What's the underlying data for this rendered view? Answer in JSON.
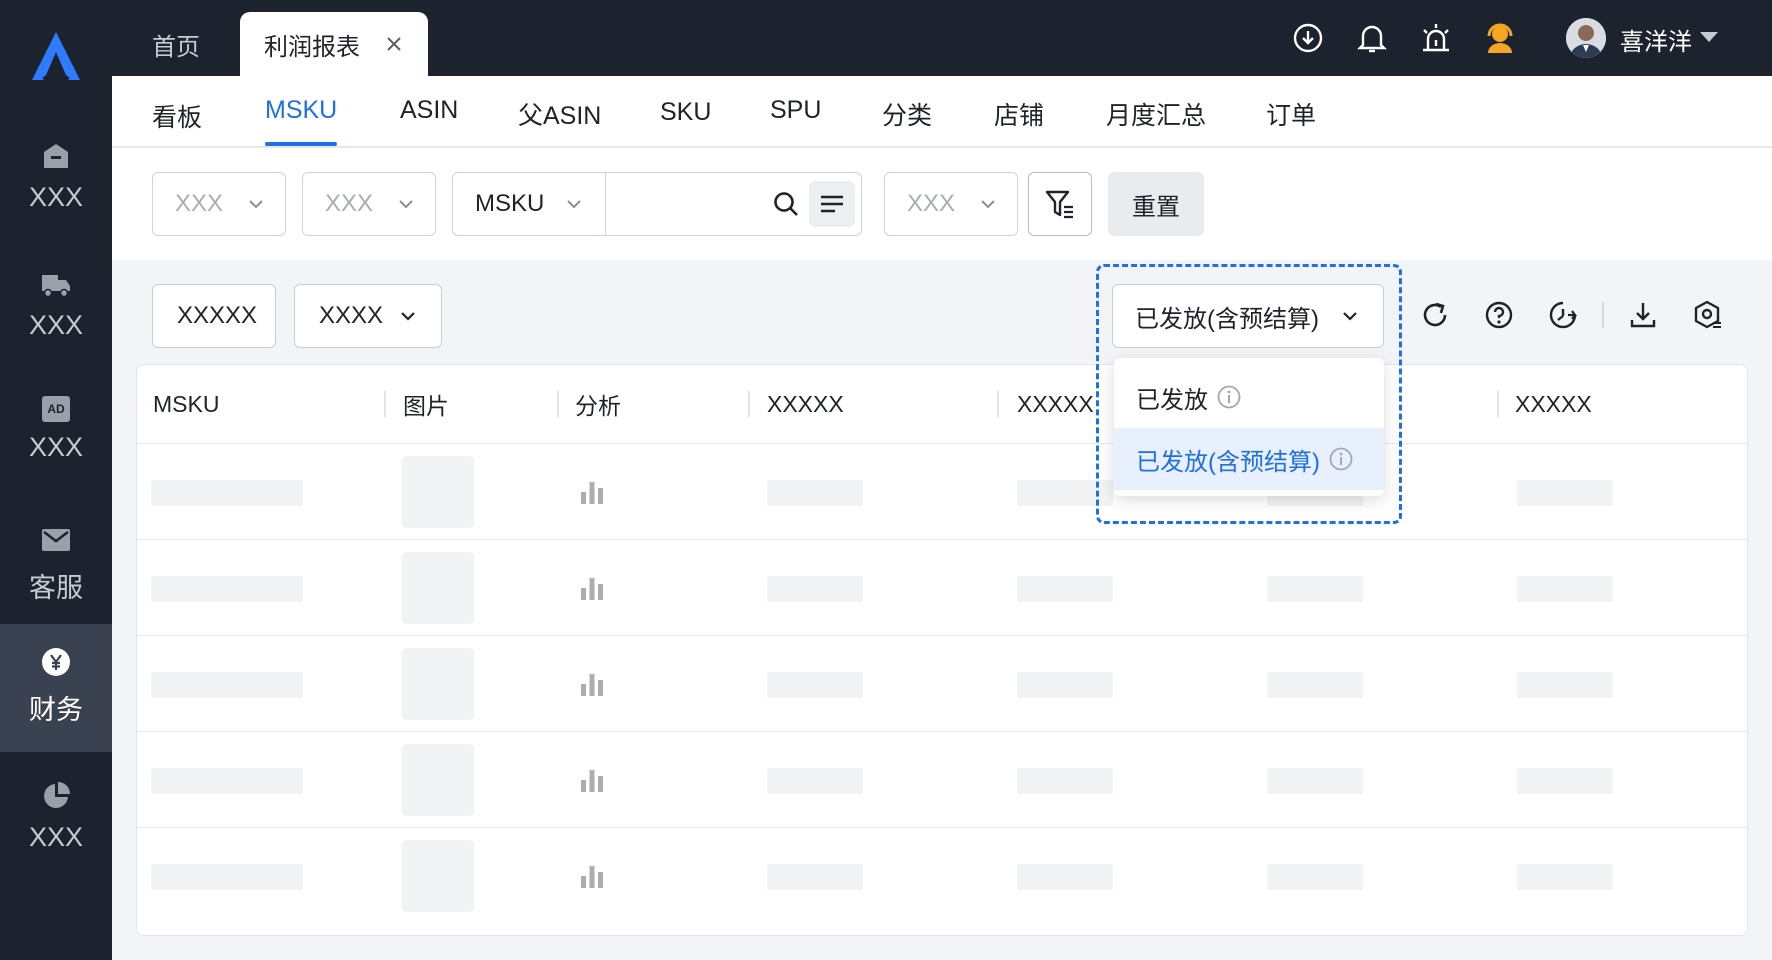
{
  "sidebar": {
    "items": [
      {
        "label": "XXX",
        "icon": "home-icon"
      },
      {
        "label": "XXX",
        "icon": "truck-icon"
      },
      {
        "label": "XXX",
        "icon": "ad-icon"
      },
      {
        "label": "客服",
        "icon": "mail-icon"
      },
      {
        "label": "财务",
        "icon": "yen-icon",
        "active": true
      },
      {
        "label": "XXX",
        "icon": "pie-chart-icon"
      }
    ],
    "ad_text": "AD"
  },
  "topbar": {
    "tabs": [
      {
        "label": "首页"
      },
      {
        "label": "利润报表",
        "active": true
      }
    ],
    "username": "喜洋洋"
  },
  "subnav": {
    "tabs": [
      "看板",
      "MSKU",
      "ASIN",
      "父ASIN",
      "SKU",
      "SPU",
      "分类",
      "店铺",
      "月度汇总",
      "订单"
    ],
    "active_index": 1
  },
  "filters": {
    "select1": "XXX",
    "select2": "XXX",
    "search_field": "MSKU",
    "search_value": "",
    "select3": "XXX",
    "reset_label": "重置"
  },
  "toolbar": {
    "button1": "XXXXX",
    "button2": "XXXX",
    "status_select": {
      "value": "已发放(含预结算)",
      "options": [
        "已发放",
        "已发放(含预结算)"
      ],
      "selected_index": 1
    }
  },
  "table": {
    "columns": [
      "MSKU",
      "图片",
      "分析",
      "XXXXX",
      "XXXXX",
      "XXXXX"
    ]
  },
  "colors": {
    "accent": "#1f6fe5",
    "sidebar_bg": "#1c222e",
    "active_nav_bg": "#3a4150"
  }
}
